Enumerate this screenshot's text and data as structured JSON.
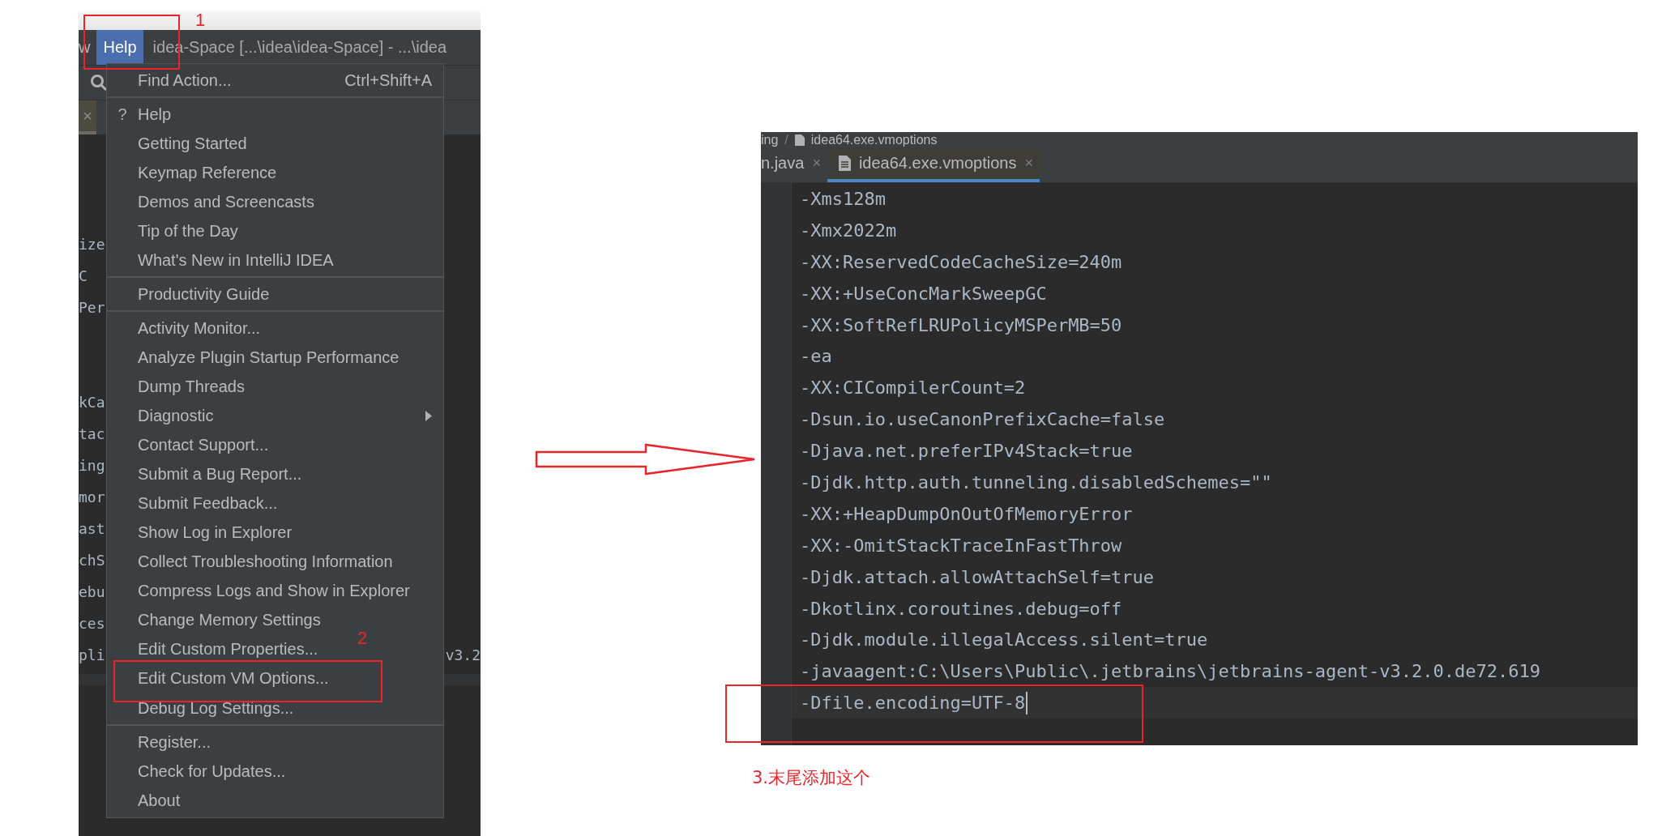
{
  "left_window": {
    "menu_bar": [
      {
        "label": "w",
        "selected": false
      },
      {
        "label": "Help",
        "selected": true
      }
    ],
    "title": "idea-Space [...\\idea\\idea-Space] - ...\\idea",
    "tab_close": "×",
    "editor_lines_top": [
      "ize",
      "C",
      "Per"
    ],
    "editor_lines_bottom": [
      "kCa",
      "tac",
      "ing",
      "mor",
      "ast",
      "chS",
      "ebu",
      "ces",
      "pli"
    ],
    "editor_right_fragment": "v3.2",
    "help_menu": [
      {
        "kind": "action",
        "label": "Find Action...",
        "shortcut": "Ctrl+Shift+A"
      },
      {
        "kind": "separator"
      },
      {
        "kind": "action",
        "label": "Help",
        "icon": "?"
      },
      {
        "kind": "action",
        "label": "Getting Started"
      },
      {
        "kind": "action",
        "label": "Keymap Reference"
      },
      {
        "kind": "action",
        "label": "Demos and Screencasts"
      },
      {
        "kind": "action",
        "label": "Tip of the Day"
      },
      {
        "kind": "action",
        "label": "What's New in IntelliJ IDEA"
      },
      {
        "kind": "separator"
      },
      {
        "kind": "action",
        "label": "Productivity Guide"
      },
      {
        "kind": "separator"
      },
      {
        "kind": "action",
        "label": "Activity Monitor..."
      },
      {
        "kind": "action",
        "label": "Analyze Plugin Startup Performance"
      },
      {
        "kind": "action",
        "label": "Dump Threads"
      },
      {
        "kind": "submenu",
        "label": "Diagnostic"
      },
      {
        "kind": "action",
        "label": "Contact Support..."
      },
      {
        "kind": "action",
        "label": "Submit a Bug Report..."
      },
      {
        "kind": "action",
        "label": "Submit Feedback..."
      },
      {
        "kind": "action",
        "label": "Show Log in Explorer"
      },
      {
        "kind": "action",
        "label": "Collect Troubleshooting Information"
      },
      {
        "kind": "action",
        "label": "Compress Logs and Show in Explorer"
      },
      {
        "kind": "action",
        "label": "Change Memory Settings"
      },
      {
        "kind": "action",
        "label": "Edit Custom Properties..."
      },
      {
        "kind": "action",
        "label": "Edit Custom VM Options..."
      },
      {
        "kind": "action",
        "label": "Debug Log Settings..."
      },
      {
        "kind": "separator"
      },
      {
        "kind": "action",
        "label": "Register..."
      },
      {
        "kind": "action",
        "label": "Check for Updates..."
      },
      {
        "kind": "action",
        "label": "About"
      }
    ]
  },
  "right_window": {
    "breadcrumb": [
      "ing",
      "idea64.exe.vmoptions"
    ],
    "breadcrumb_separator": "/",
    "tabs": [
      {
        "label": "n.java",
        "close": "×",
        "selected": false
      },
      {
        "label": "idea64.exe.vmoptions",
        "close": "×",
        "selected": true
      }
    ],
    "lines": [
      {
        "text": "-Xms128m",
        "current": false
      },
      {
        "text": "-Xmx2022m",
        "current": false
      },
      {
        "text": "-XX:ReservedCodeCacheSize=240m",
        "current": false
      },
      {
        "text": "-XX:+UseConcMarkSweepGC",
        "current": false
      },
      {
        "text": "-XX:SoftRefLRUPolicyMSPerMB=50",
        "current": false
      },
      {
        "text": "-ea",
        "current": false
      },
      {
        "text": "-XX:CICompilerCount=2",
        "current": false
      },
      {
        "text": "-Dsun.io.useCanonPrefixCache=false",
        "current": false
      },
      {
        "text": "-Djava.net.preferIPv4Stack=true",
        "current": false
      },
      {
        "text": "-Djdk.http.auth.tunneling.disabledSchemes=\"\"",
        "current": false
      },
      {
        "text": "-XX:+HeapDumpOnOutOfMemoryError",
        "current": false
      },
      {
        "text": "-XX:-OmitStackTraceInFastThrow",
        "current": false
      },
      {
        "text": "-Djdk.attach.allowAttachSelf=true",
        "current": false
      },
      {
        "text": "-Dkotlinx.coroutines.debug=off",
        "current": false
      },
      {
        "text": "-Djdk.module.illegalAccess.silent=true",
        "current": false
      },
      {
        "text": "-javaagent:C:\\Users\\Public\\.jetbrains\\jetbrains-agent-v3.2.0.de72.619",
        "current": false
      },
      {
        "text": "-Dfile.encoding=UTF-8",
        "current": true
      }
    ]
  },
  "step_labels": [
    "1",
    "2",
    "3.末尾添加这个"
  ]
}
